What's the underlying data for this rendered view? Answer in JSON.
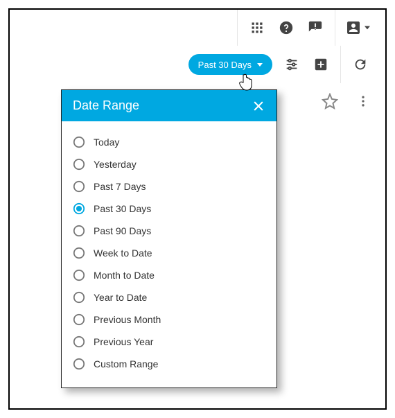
{
  "colors": {
    "accent": "#00A8E1",
    "icon": "#444444",
    "text": "#333333"
  },
  "topbar": {
    "apps_icon": "apps",
    "help_icon": "help",
    "announce_icon": "announcement",
    "account_icon": "account"
  },
  "toolbar": {
    "date_pill_label": "Past 30 Days",
    "tune_icon": "tune",
    "add_icon": "add-box",
    "refresh_icon": "refresh"
  },
  "rightcol": {
    "star_icon": "star-outline",
    "more_icon": "more-vert"
  },
  "panel": {
    "title": "Date Range",
    "close_icon": "close",
    "selected_index": 3,
    "options": [
      {
        "label": "Today"
      },
      {
        "label": "Yesterday"
      },
      {
        "label": "Past 7 Days"
      },
      {
        "label": "Past 30 Days"
      },
      {
        "label": "Past 90 Days"
      },
      {
        "label": "Week to Date"
      },
      {
        "label": "Month to Date"
      },
      {
        "label": "Year to Date"
      },
      {
        "label": "Previous Month"
      },
      {
        "label": "Previous Year"
      },
      {
        "label": "Custom Range"
      }
    ]
  }
}
